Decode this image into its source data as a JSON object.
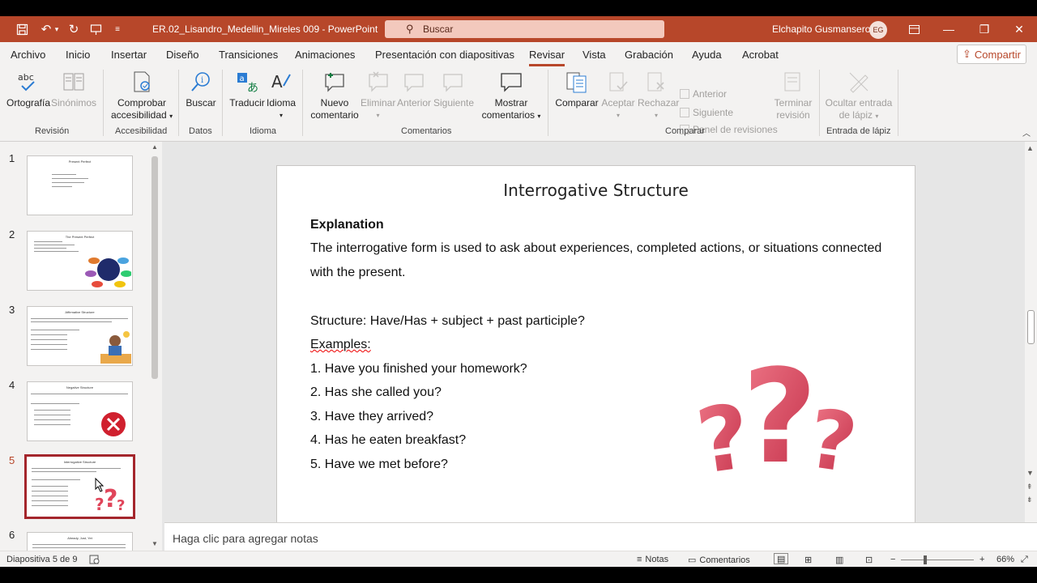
{
  "titlebar": {
    "doc_title": "ER.02_Lisandro_Medellin_Mireles 009  -  PowerPoint",
    "search_placeholder": "Buscar",
    "user_name": "Elchapito Gusmansero",
    "user_initials": "EG"
  },
  "menu": {
    "tabs": [
      "Archivo",
      "Inicio",
      "Insertar",
      "Diseño",
      "Transiciones",
      "Animaciones",
      "Presentación con diapositivas",
      "Revisar",
      "Vista",
      "Grabación",
      "Ayuda",
      "Acrobat"
    ],
    "active": "Revisar",
    "share_label": "Compartir"
  },
  "ribbon": {
    "spelling": "Ortografía",
    "synonyms": "Sinónimos",
    "check_access_1": "Comprobar",
    "check_access_2": "accesibilidad",
    "search": "Buscar",
    "translate": "Traducir",
    "language": "Idioma",
    "new_comment_1": "Nuevo",
    "new_comment_2": "comentario",
    "delete": "Eliminar",
    "previous": "Anterior",
    "next": "Siguiente",
    "show_comments_1": "Mostrar",
    "show_comments_2": "comentarios",
    "compare": "Comparar",
    "accept": "Aceptar",
    "reject": "Rechazar",
    "prev_small": "Anterior",
    "next_small": "Siguiente",
    "revisions_pane": "Panel de revisiones",
    "end_review_1": "Terminar",
    "end_review_2": "revisión",
    "hide_ink_1": "Ocultar entrada",
    "hide_ink_2": "de lápiz",
    "groups": {
      "revision": "Revisión",
      "accessibility": "Accesibilidad",
      "data": "Datos",
      "language": "Idioma",
      "comments": "Comentarios",
      "compare": "Comparar",
      "ink": "Entrada de lápiz"
    }
  },
  "thumbnails": {
    "numbers": [
      "1",
      "2",
      "3",
      "4",
      "5",
      "6"
    ],
    "titles": [
      "Present Perfect",
      "The Present Perfect",
      "Affirmative Structure",
      "Negative Structure",
      "Interrogative Structure",
      "Already, Just, Yet"
    ],
    "active_index": 5
  },
  "slide": {
    "title": "Interrogative Structure",
    "heading": "Explanation",
    "line1": "The interrogative form is used to ask about experiences, completed actions, or situations connected",
    "line2": "with the present.",
    "structure": "Structure: Have/Has + subject + past participle?",
    "examples_label": "Examples:",
    "examples": [
      "1. Have you finished your homework?",
      "2. Has she called you?",
      "3. Have they arrived?",
      "4. Has he eaten breakfast?",
      "5. Have we met before?"
    ]
  },
  "notes_placeholder": "Haga clic para agregar notas",
  "status": {
    "slide_counter": "Diapositiva 5 de 9",
    "notes": "Notas",
    "comments": "Comentarios",
    "zoom": "66%"
  },
  "colors": {
    "brand": "#b7472a",
    "active_thumb_border": "#a4262c"
  }
}
